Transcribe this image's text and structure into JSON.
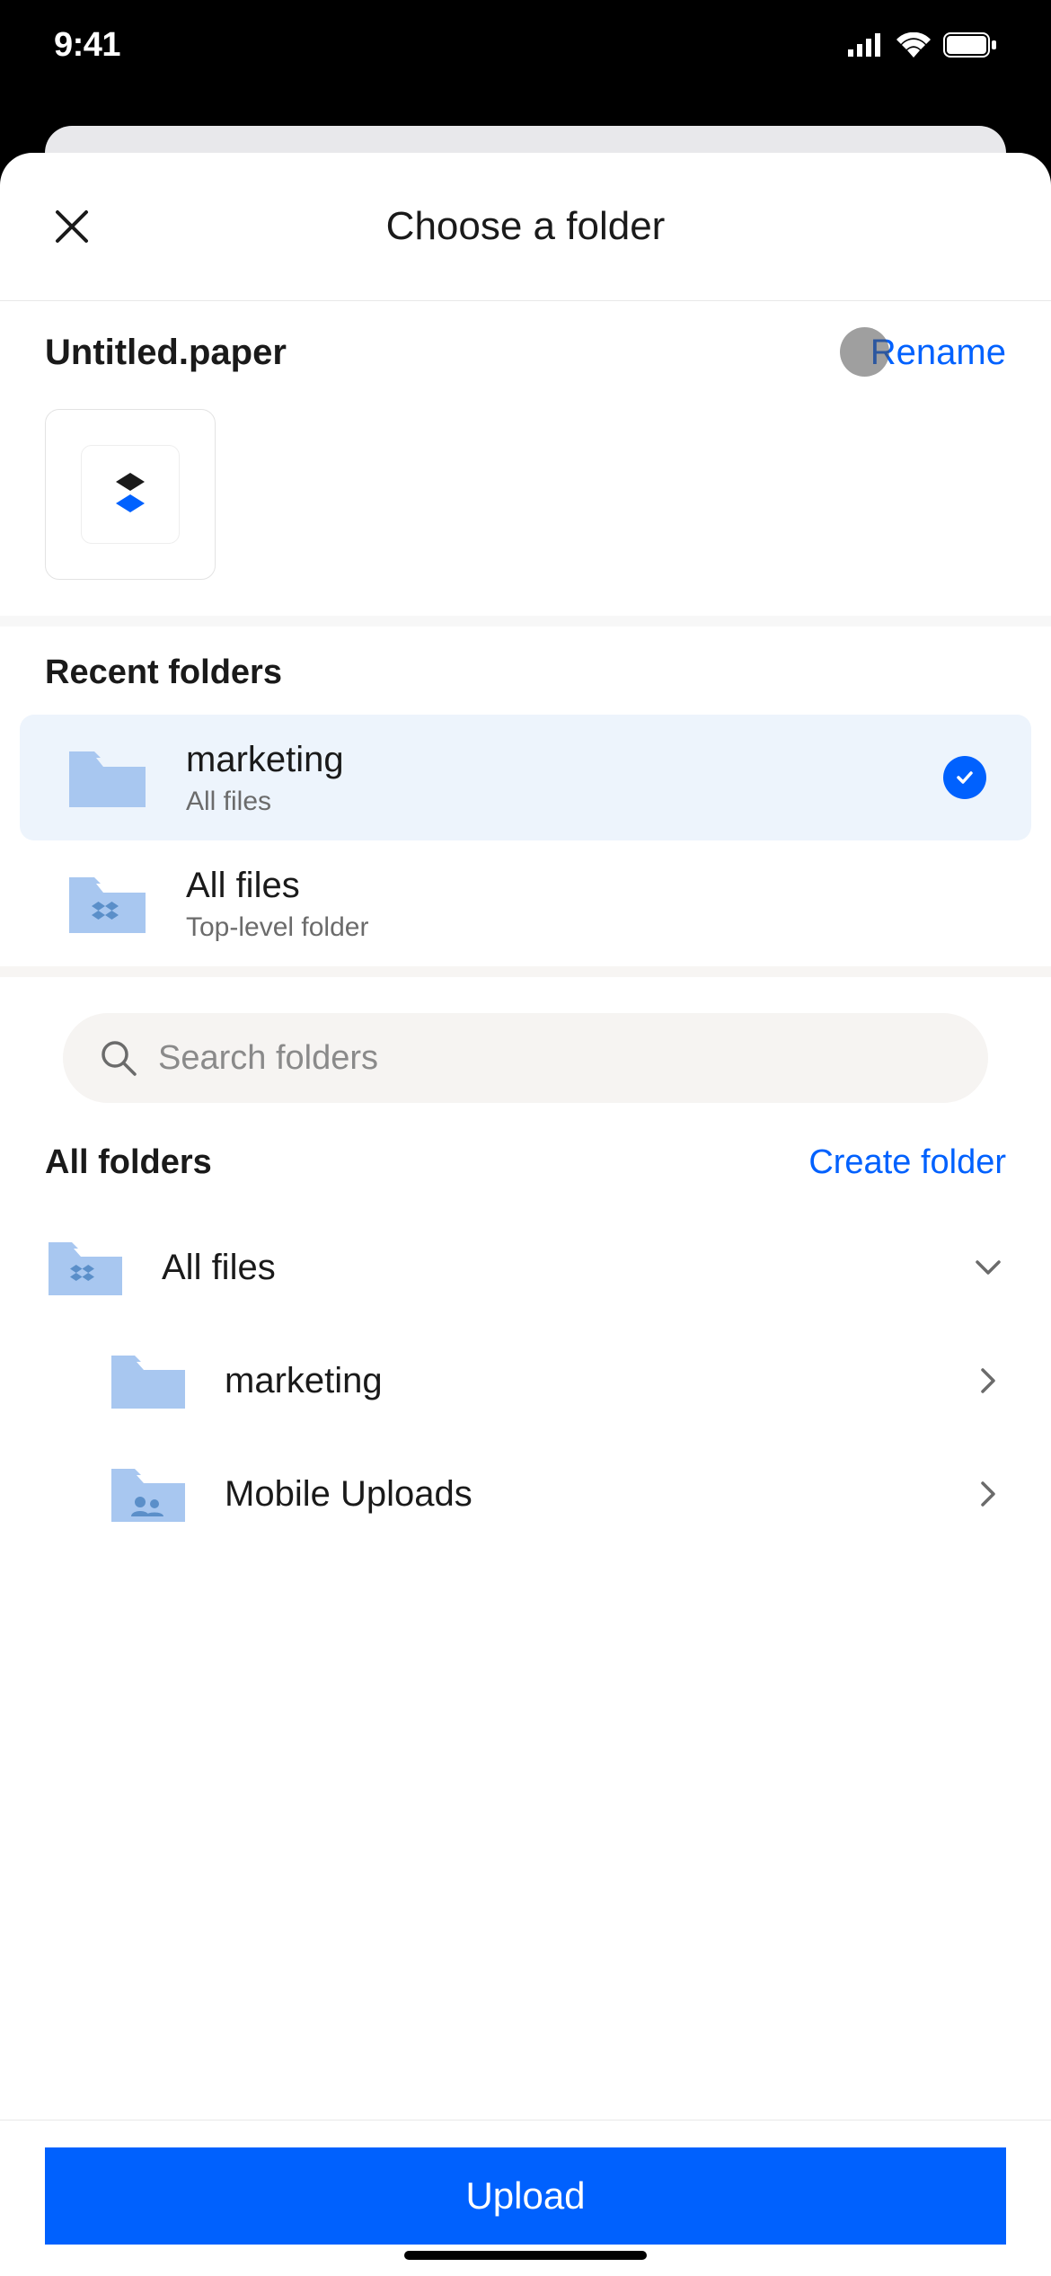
{
  "status": {
    "time": "9:41"
  },
  "header": {
    "title": "Choose a folder"
  },
  "file": {
    "name": "Untitled.paper",
    "rename_label": "Rename"
  },
  "recent": {
    "title": "Recent folders",
    "items": [
      {
        "name": "marketing",
        "subtitle": "All files",
        "selected": true
      },
      {
        "name": "All files",
        "subtitle": "Top-level folder",
        "selected": false
      }
    ]
  },
  "search": {
    "placeholder": "Search folders"
  },
  "all": {
    "title": "All folders",
    "create_label": "Create folder",
    "tree": {
      "root": "All files",
      "children": [
        {
          "name": "marketing"
        },
        {
          "name": "Mobile Uploads"
        }
      ]
    }
  },
  "upload": {
    "label": "Upload"
  }
}
